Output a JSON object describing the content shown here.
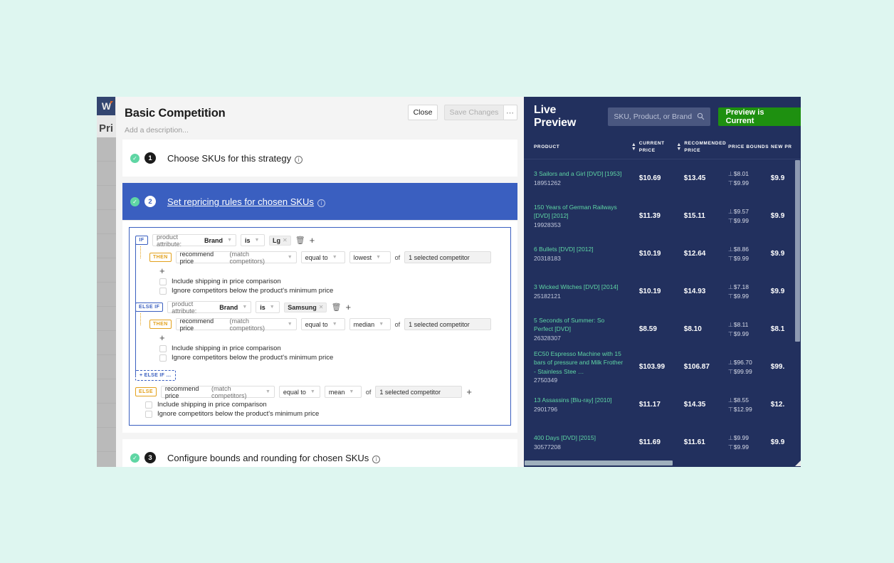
{
  "background_app": {
    "logo": "W",
    "page_title": "Pri"
  },
  "modal": {
    "title": "Basic Competition",
    "description_placeholder": "Add a description...",
    "close_label": "Close",
    "save_label": "Save Changes",
    "more_label": "…",
    "steps": [
      {
        "number": "1",
        "label": "Choose SKUs for this strategy",
        "active": false
      },
      {
        "number": "2",
        "label": "Set repricing rules for chosen SKUs",
        "active": true
      },
      {
        "number": "3",
        "label": "Configure bounds and rounding for chosen SKUs",
        "active": false
      }
    ],
    "rules": {
      "if_badge": "IF",
      "elseif_badge": "ELSE IF",
      "then_badge": "THEN",
      "else_badge": "ELSE",
      "add_elseif_label": "+ ELSE IF …",
      "attribute_label": "product attribute:",
      "operator_label": "is",
      "of_label": "of",
      "action_label": "recommend price",
      "action_hint": "(match competitors)",
      "comparator_label": "equal to",
      "competitor_value": "1 selected competitor",
      "checkbox_shipping": "Include shipping in price comparison",
      "checkbox_ignore": "Ignore competitors below the product's minimum price",
      "branches": [
        {
          "kind": "if",
          "attribute_value": "Brand",
          "tag": "Lg",
          "aggregate": "lowest"
        },
        {
          "kind": "else if",
          "attribute_value": "Brand",
          "tag": "Samsung",
          "aggregate": "median"
        },
        {
          "kind": "else",
          "aggregate": "mean"
        }
      ]
    }
  },
  "preview": {
    "title": "Live Preview",
    "search_placeholder": "SKU, Product, or Brand",
    "search_icon": "search-icon",
    "status_button": "Preview is Current",
    "columns": [
      {
        "key": "product",
        "label": "PRODUCT",
        "sortable": true
      },
      {
        "key": "current_price",
        "label": "CURRENT PRICE",
        "sortable": true
      },
      {
        "key": "recommended_price",
        "label": "RECOMMENDED PRICE",
        "sortable": false
      },
      {
        "key": "price_bounds",
        "label": "PRICE BOUNDS",
        "sortable": false
      },
      {
        "key": "new_price",
        "label": "NEW PR",
        "sortable": false
      }
    ],
    "rows": [
      {
        "product": "3 Sailors and a Girl [DVD] [1953]",
        "sku": "18951262",
        "current_price": "$10.69",
        "recommended_price": "$13.45",
        "bound_min": "$8.01",
        "bound_max": "$9.99",
        "new_price": "$9.9"
      },
      {
        "product": "150 Years of German Railways [DVD] [2012]",
        "sku": "19928353",
        "current_price": "$11.39",
        "recommended_price": "$15.11",
        "bound_min": "$9.57",
        "bound_max": "$9.99",
        "new_price": "$9.9"
      },
      {
        "product": "6 Bullets [DVD] [2012]",
        "sku": "20318183",
        "current_price": "$10.19",
        "recommended_price": "$12.64",
        "bound_min": "$8.86",
        "bound_max": "$9.99",
        "new_price": "$9.9"
      },
      {
        "product": "3 Wicked Witches [DVD] [2014]",
        "sku": "25182121",
        "current_price": "$10.19",
        "recommended_price": "$14.93",
        "bound_min": "$7.18",
        "bound_max": "$9.99",
        "new_price": "$9.9"
      },
      {
        "product": "5 Seconds of Summer: So Perfect [DVD]",
        "sku": "26328307",
        "current_price": "$8.59",
        "recommended_price": "$8.10",
        "bound_min": "$8.11",
        "bound_max": "$9.99",
        "new_price": "$8.1"
      },
      {
        "product": "EC50 Espresso Machine with 15 bars of pressure and Milk Frother - Stainless Stee …",
        "sku": "2750349",
        "current_price": "$103.99",
        "recommended_price": "$106.87",
        "bound_min": "$96.70",
        "bound_max": "$99.99",
        "new_price": "$99."
      },
      {
        "product": "13 Assassins [Blu-ray] [2010]",
        "sku": "2901796",
        "current_price": "$11.17",
        "recommended_price": "$14.35",
        "bound_min": "$8.55",
        "bound_max": "$12.99",
        "new_price": "$12."
      },
      {
        "product": "400 Days [DVD] [2015]",
        "sku": "30577208",
        "current_price": "$11.69",
        "recommended_price": "$11.61",
        "bound_min": "$9.99",
        "bound_max": "$9.99",
        "new_price": "$9.9"
      }
    ]
  },
  "colors": {
    "page_background": "#def6f0",
    "accent_blue": "#3a5fc0",
    "accent_orange": "#e3a11c",
    "preview_navy": "#22305e",
    "status_green": "#1e9010",
    "product_link_green": "#5fd6a4"
  }
}
